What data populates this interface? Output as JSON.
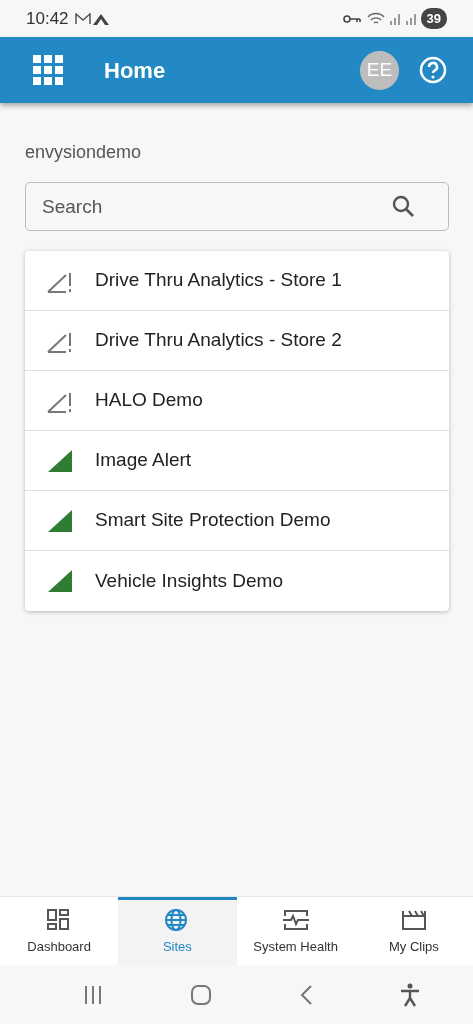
{
  "status_bar": {
    "time": "10:42",
    "battery": "39"
  },
  "app_bar": {
    "title": "Home",
    "avatar": "EE"
  },
  "account": "envysiondemo",
  "search": {
    "placeholder": "Search"
  },
  "sites": [
    {
      "name": "Drive Thru Analytics - Store 1",
      "kind": "alert"
    },
    {
      "name": "Drive Thru Analytics - Store 2",
      "kind": "alert"
    },
    {
      "name": "HALO Demo",
      "kind": "alert"
    },
    {
      "name": "Image Alert",
      "kind": "ok"
    },
    {
      "name": "Smart Site Protection Demo",
      "kind": "ok"
    },
    {
      "name": "Vehicle Insights Demo",
      "kind": "ok"
    }
  ],
  "tabs": [
    {
      "label": "Dashboard",
      "kind": "dashboard",
      "selected": false
    },
    {
      "label": "Sites",
      "kind": "globe",
      "selected": true
    },
    {
      "label": "System Health",
      "kind": "pulse",
      "selected": false
    },
    {
      "label": "My Clips",
      "kind": "clapper",
      "selected": false
    }
  ]
}
